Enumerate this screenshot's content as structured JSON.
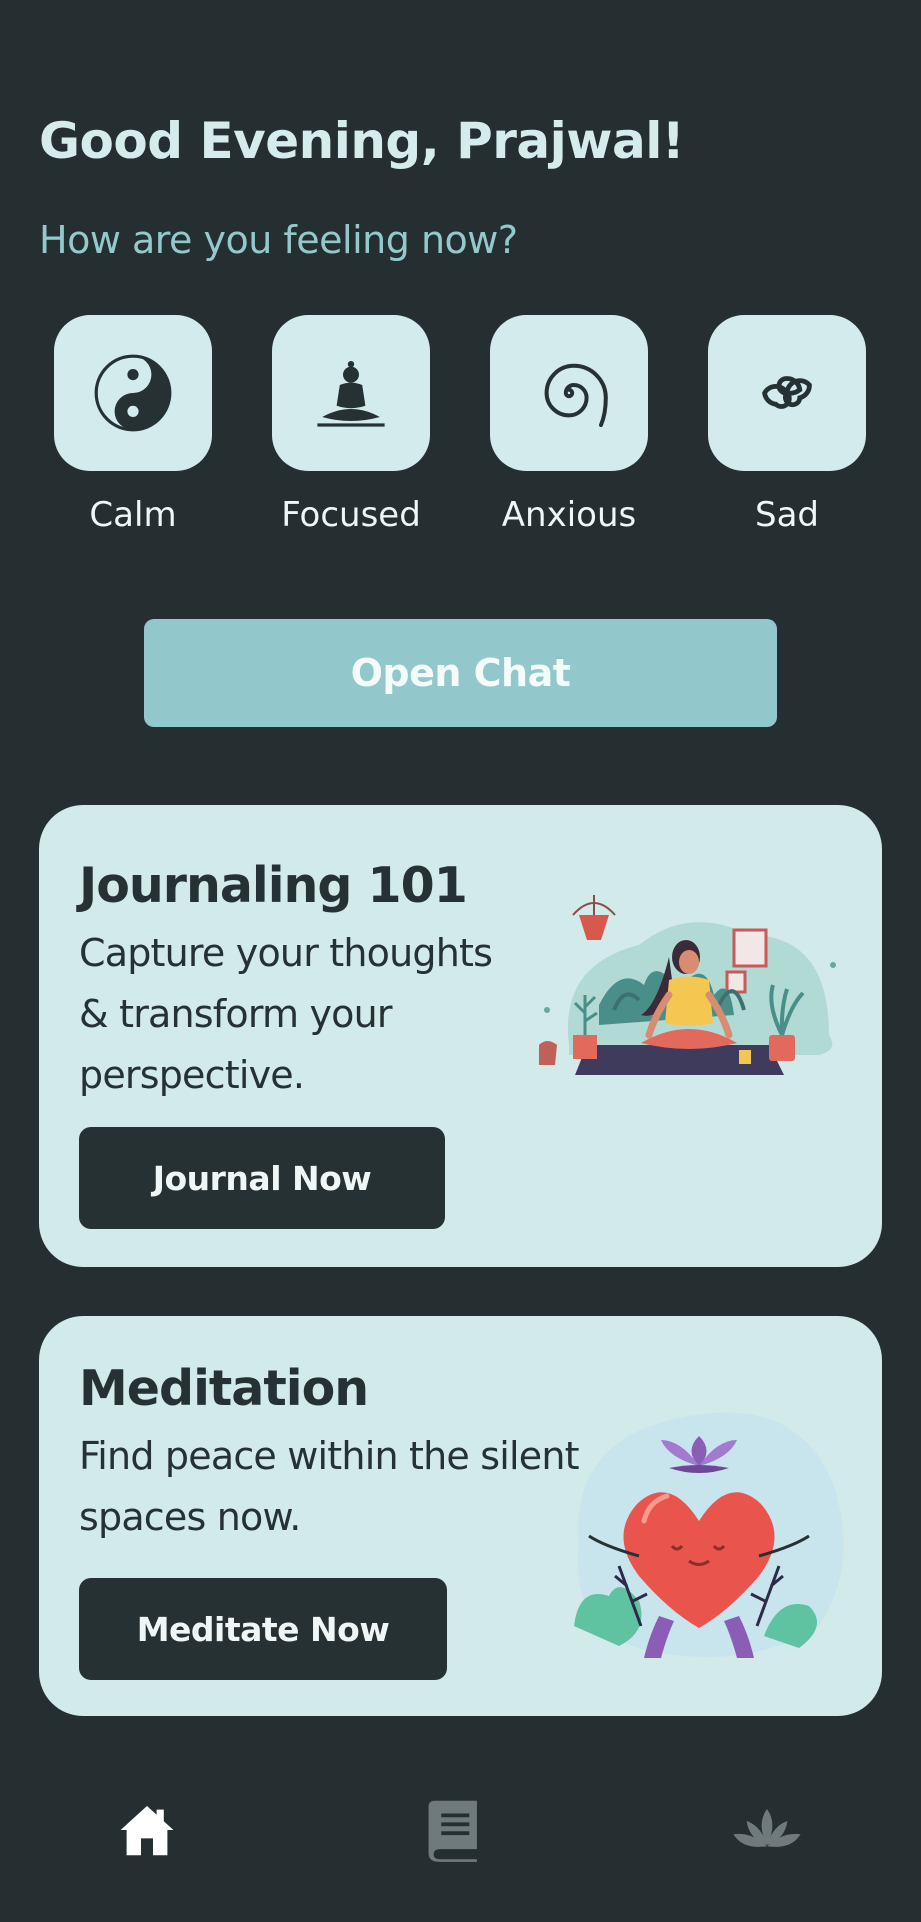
{
  "header": {
    "greeting": "Good Evening, Prajwal!",
    "subtitle": "How are you feeling now?"
  },
  "moods": [
    {
      "label": "Calm",
      "icon": "yin-yang-icon"
    },
    {
      "label": "Focused",
      "icon": "meditating-buddha-icon"
    },
    {
      "label": "Anxious",
      "icon": "spiral-icon"
    },
    {
      "label": "Sad",
      "icon": "triskelion-icon"
    }
  ],
  "open_chat": {
    "label": "Open Chat"
  },
  "cards": {
    "journaling": {
      "title": "Journaling 101",
      "description": "Capture your thoughts & transform your perspective.",
      "button": "Journal Now",
      "illustration": "woman-meditating-with-plants-illustration"
    },
    "meditation": {
      "title": "Meditation",
      "description": "Find peace within the silent spaces now.",
      "button": "Meditate Now",
      "illustration": "heart-meditating-lotus-illustration"
    }
  },
  "bottom_nav": [
    {
      "icon": "home-icon",
      "active": true
    },
    {
      "icon": "book-icon",
      "active": false
    },
    {
      "icon": "lotus-icon",
      "active": false
    }
  ],
  "colors": {
    "background": "#252f31",
    "card": "#d3eaeb",
    "accent": "#92c8cb",
    "dark_button": "#263133",
    "greeting_text": "#d6ecec",
    "subtitle_text": "#93c9cb"
  }
}
